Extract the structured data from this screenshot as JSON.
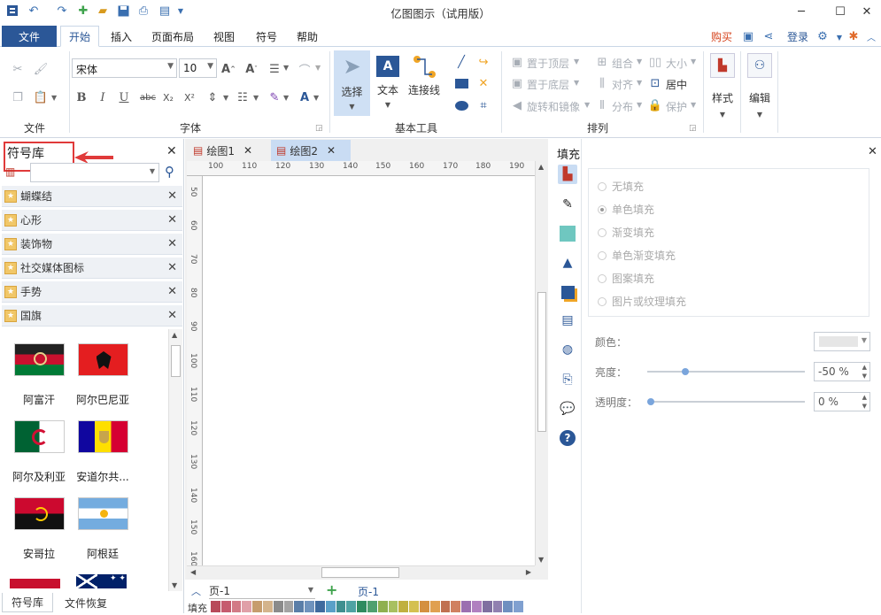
{
  "app": {
    "title": "亿图图示（试用版）"
  },
  "menu": {
    "file": "文件",
    "tabs": [
      "开始",
      "插入",
      "页面布局",
      "视图",
      "符号",
      "帮助"
    ],
    "right": {
      "buy": "购买",
      "login": "登录"
    }
  },
  "ribbon": {
    "groups": {
      "file": "文件",
      "font": "字体",
      "basic_tools": "基本工具",
      "arrange": "排列"
    },
    "font_name": "宋体",
    "font_size": "10",
    "bold": "B",
    "italic": "I",
    "underline": "U",
    "strike": "abc",
    "subscript": "X₂",
    "superscript": "X²",
    "tools": {
      "select": "选择",
      "text": "文本",
      "connector": "连接线"
    },
    "arrange": {
      "bring_front": "置于顶层",
      "send_back": "置于底层",
      "rotate_mirror": "旋转和镜像",
      "group": "组合",
      "align": "对齐",
      "distribute": "分布",
      "size": "大小",
      "center": "居中",
      "protect": "保护"
    },
    "style": "样式",
    "edit": "编辑"
  },
  "symbol_panel": {
    "title": "符号库",
    "search_placeholder": "",
    "categories": [
      "蝴蝶结",
      "心形",
      "装饰物",
      "社交媒体图标",
      "手势",
      "国旗"
    ],
    "flags": [
      "阿富汗",
      "阿尔巴尼亚",
      "阿尔及利亚",
      "安道尔共...",
      "安哥拉",
      "阿根廷"
    ],
    "bottom_tabs": [
      "符号库",
      "文件恢复"
    ]
  },
  "documents": {
    "tabs": [
      "绘图1",
      "绘图2"
    ],
    "active": 1
  },
  "ruler": {
    "h": [
      "100",
      "110",
      "120",
      "130",
      "140",
      "150",
      "160",
      "170",
      "180",
      "190"
    ],
    "v": [
      "50",
      "60",
      "70",
      "80",
      "90",
      "100",
      "110",
      "120",
      "130",
      "140",
      "150",
      "160"
    ]
  },
  "pages": {
    "current": "页-1",
    "tab": "页-1"
  },
  "fill_bar_label": "填充",
  "fill_panel": {
    "title": "填充",
    "options": [
      "无填充",
      "单色填充",
      "渐变填充",
      "单色渐变填充",
      "图案填充",
      "图片或纹理填充"
    ],
    "selected": 1,
    "color_label": "颜色：",
    "brightness_label": "亮度：",
    "brightness_value": "-50 %",
    "brightness_level": 0.24,
    "transparency_label": "透明度：",
    "transparency_value": "0 %",
    "transparency_level": 0.0
  },
  "colors": {
    "accent": "#2b5797",
    "annotation": "#e03a3a"
  }
}
